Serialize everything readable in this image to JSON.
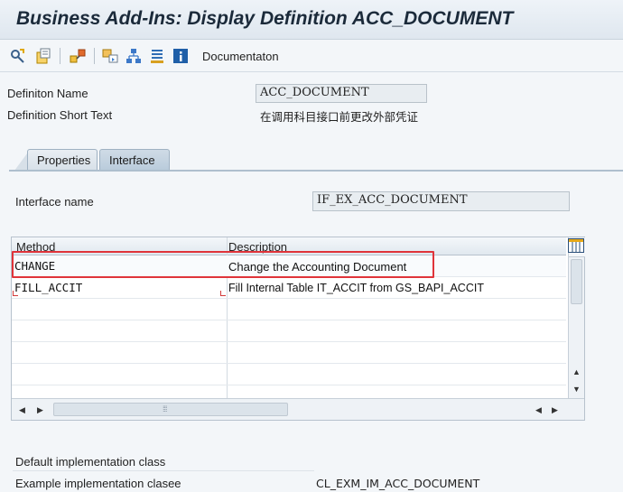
{
  "window": {
    "title": "Business Add-Ins: Display Definition ACC_DOCUMENT"
  },
  "toolbar": {
    "icons": [
      "other-object-icon",
      "display-change-icon",
      "where-used-icon",
      "object-list-icon",
      "hierarchy-icon",
      "settings-icon",
      "info-icon"
    ],
    "documentation_label": "Documentaton"
  },
  "definition": {
    "name_label": "Definiton Name",
    "name_value": "ACC_DOCUMENT",
    "short_text_label": "Definition Short Text",
    "short_text_value": "在调用科目接口前更改外部凭证"
  },
  "tabs": [
    {
      "label": "Properties",
      "active": false
    },
    {
      "label": "Interface",
      "active": true
    }
  ],
  "interface": {
    "name_label": "Interface name",
    "name_value": "IF_EX_ACC_DOCUMENT"
  },
  "methods_table": {
    "columns": [
      "Method",
      "Description"
    ],
    "rows": [
      {
        "method": "CHANGE",
        "description": "Change the Accounting Document"
      },
      {
        "method": "FILL_ACCIT",
        "description": "Fill Internal Table IT_ACCIT from GS_BAPI_ACCIT"
      },
      {
        "method": "",
        "description": ""
      },
      {
        "method": "",
        "description": ""
      },
      {
        "method": "",
        "description": ""
      },
      {
        "method": "",
        "description": ""
      }
    ]
  },
  "impl": {
    "default_label": "Default implementation class",
    "default_value": "",
    "example_label": "Example implementation clasee",
    "example_value": "CL_EXM_IM_ACC_DOCUMENT"
  },
  "colors": {
    "highlight": "#e0343a",
    "tab_active": "#b9cbdb"
  }
}
